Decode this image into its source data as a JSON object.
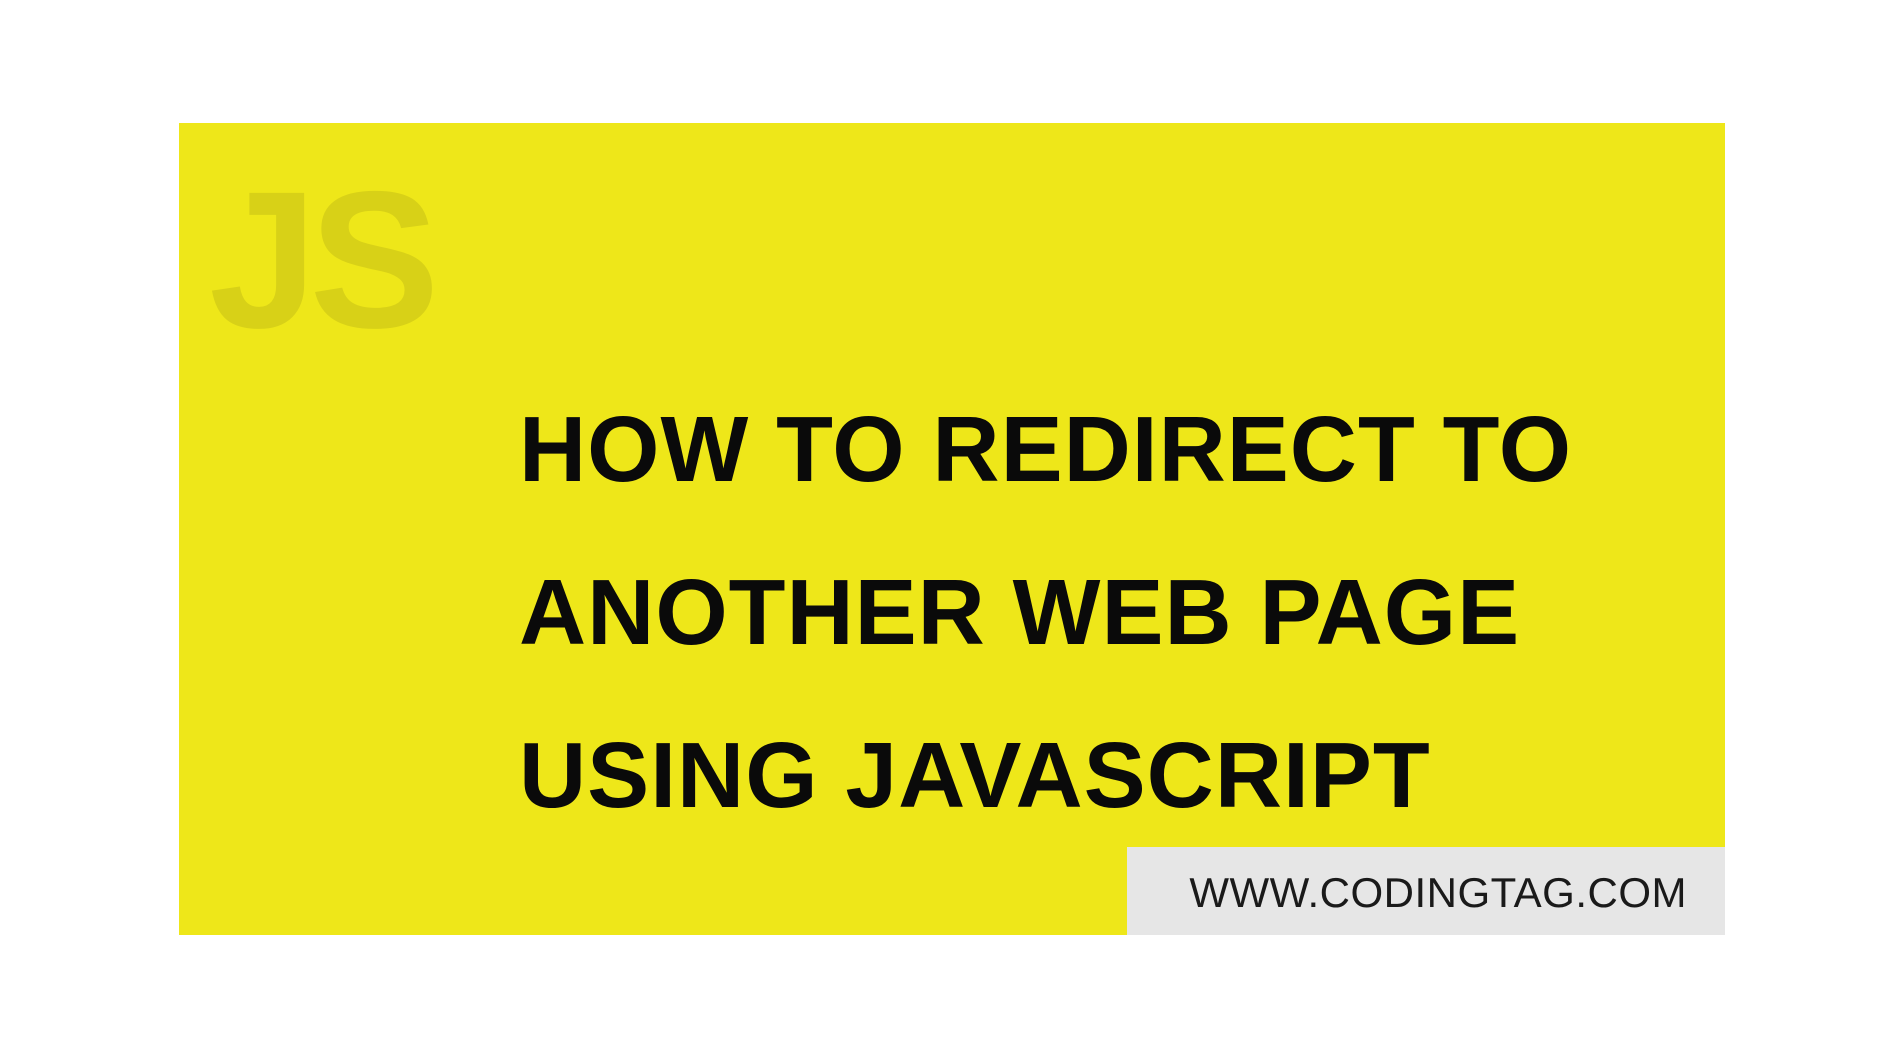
{
  "watermark": "JS",
  "headline": {
    "line1": "HOW TO REDIRECT TO",
    "line2": "ANOTHER WEB PAGE",
    "line3": "USING JAVASCRIPT"
  },
  "url": "WWW.CODINGTAG.COM"
}
